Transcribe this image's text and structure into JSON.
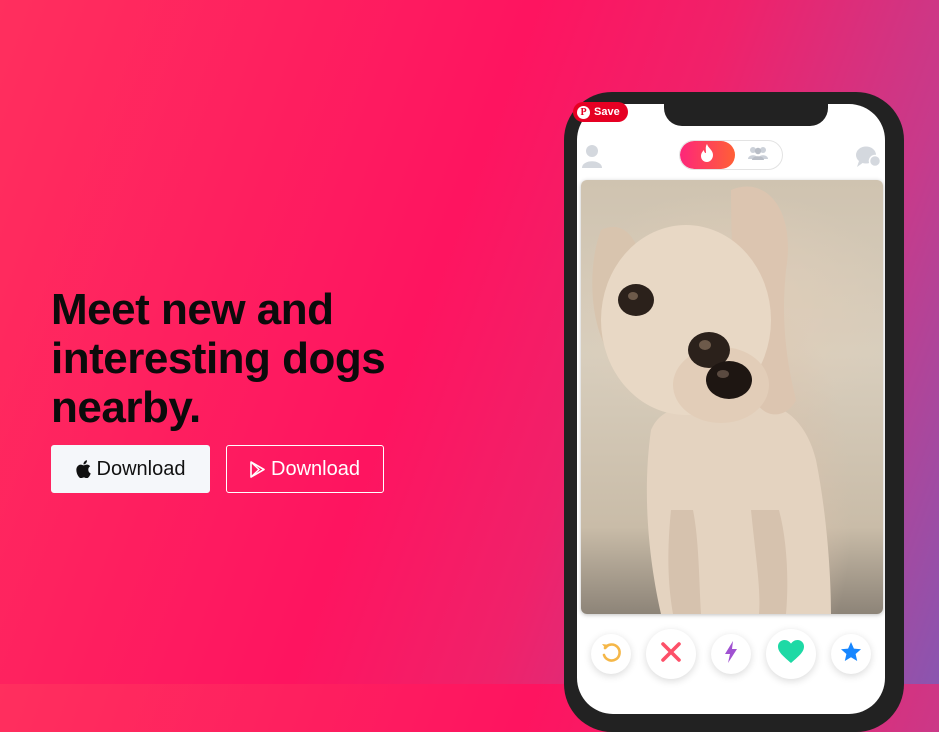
{
  "hero": {
    "headline_line1": "Meet new and",
    "headline_line2": "interesting dogs",
    "headline_line3": "nearby."
  },
  "buttons": {
    "ios_label": "Download",
    "ios_icon": "apple-icon",
    "android_label": "Download",
    "android_icon": "google-play-icon"
  },
  "pinterest": {
    "save_label": "Save",
    "logo_letter": "P"
  },
  "phone": {
    "toggle": {
      "selected": "flame-icon",
      "other": "group-icon"
    },
    "photo_subject": "dog-photo",
    "actions": [
      "rewind-icon",
      "nope-icon",
      "boost-icon",
      "like-icon",
      "super-like-icon"
    ]
  },
  "colors": {
    "brand_gradient_start": "#fd267a",
    "brand_gradient_end": "#ff6036",
    "rewind": "#f5b748",
    "nope": "#fd5068",
    "boost": "#a052d1",
    "like": "#1ed9a5",
    "super_like": "#1786ff",
    "pinterest_red": "#e60023"
  }
}
